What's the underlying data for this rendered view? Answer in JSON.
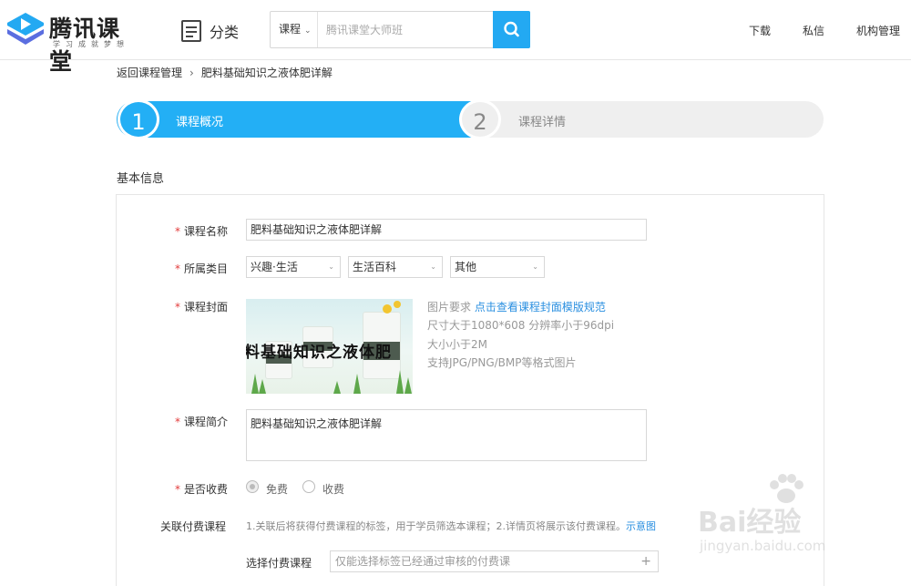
{
  "header": {
    "logo_text": "腾讯课堂",
    "logo_slogan": "学习成就梦想",
    "category_label": "分类",
    "search": {
      "type_label": "课程",
      "placeholder": "腾讯课堂大师班"
    },
    "nav": [
      "下载",
      "私信",
      "机构管理"
    ]
  },
  "breadcrumb": {
    "back": "返回课程管理",
    "current": "肥料基础知识之液体肥详解"
  },
  "steps": [
    {
      "number": "1",
      "label": "课程概况"
    },
    {
      "number": "2",
      "label": "课程详情"
    }
  ],
  "section_title": "基本信息",
  "form": {
    "course_name": {
      "label": "课程名称",
      "value": "肥料基础知识之液体肥详解"
    },
    "category": {
      "label": "所属类目",
      "options": [
        "兴趣·生活",
        "生活百科",
        "其他"
      ]
    },
    "cover": {
      "label": "课程封面",
      "image_text": "料基础知识之液体肥",
      "req_prefix": "图片要求",
      "req_link": "点击查看课程封面模版规范",
      "req_lines": [
        "尺寸大于1080*608 分辨率小于96dpi",
        "大小小于2M",
        "支持JPG/PNG/BMP等格式图片"
      ]
    },
    "intro": {
      "label": "课程简介",
      "value": "肥料基础知识之液体肥详解"
    },
    "paid": {
      "label": "是否收费",
      "options": [
        "免费",
        "收费"
      ]
    },
    "related": {
      "label": "关联付费课程",
      "note": "1.关联后将获得付费课程的标签，用于学员筛选本课程；2.详情页将展示该付费课程。",
      "note_link": "示意图",
      "pick_label": "选择付费课程",
      "pick_placeholder": "仅能选择标签已经通过审核的付费课"
    }
  },
  "watermark": {
    "text": "Bai经验",
    "sub": "jingyan.baidu.com"
  },
  "colors": {
    "accent": "#23aff5",
    "required": "#e23b3b",
    "link": "#2a8fe0"
  }
}
